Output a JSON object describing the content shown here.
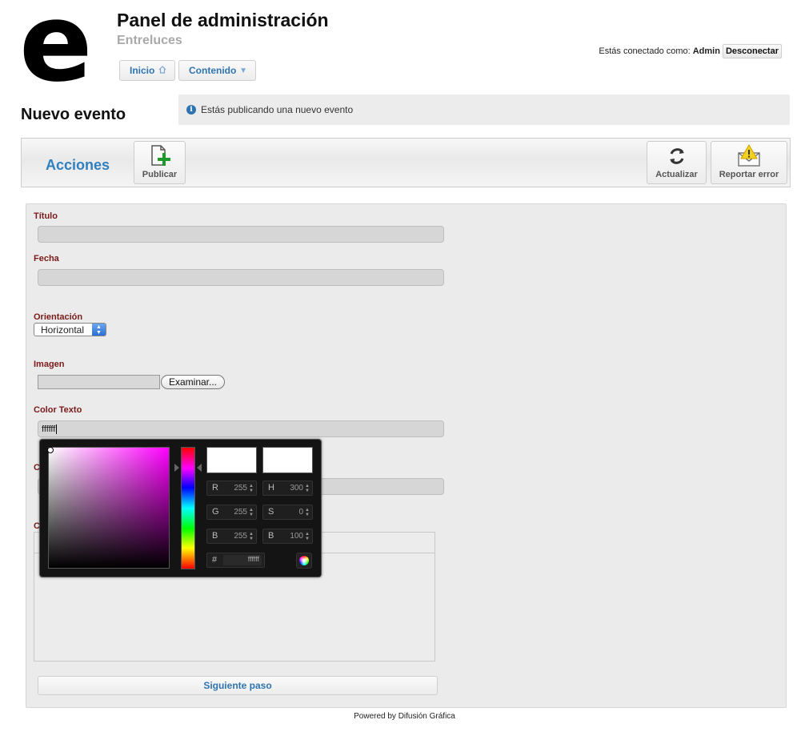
{
  "header": {
    "logo_letter": "e",
    "title": "Panel de administración",
    "subtitle": "Entreluces",
    "nav": [
      {
        "label": "Inicio",
        "icon": "home-icon"
      },
      {
        "label": "Contenido",
        "icon": "dropdown-arrow-icon"
      }
    ],
    "user_prefix": "Estás conectado como:",
    "user_name": "Admin",
    "logout_label": "Desconectar"
  },
  "page": {
    "title": "Nuevo evento",
    "notice": "Estás publicando una nuevo evento"
  },
  "toolbar": {
    "section_label": "Acciones",
    "publish_label": "Publicar",
    "refresh_label": "Actualizar",
    "report_label": "Reportar error"
  },
  "form": {
    "titulo_label": "Título",
    "titulo_value": "",
    "fecha_label": "Fecha",
    "fecha_value": "",
    "orientacion_label": "Orientación",
    "orientacion_value": "Horizontal",
    "imagen_label": "Imagen",
    "browse_label": "Examinar...",
    "color_label": "Color Texto",
    "color_value": "ffffff",
    "next_label": "Siguiente paso"
  },
  "color_picker": {
    "r": "255",
    "g": "255",
    "b": "255",
    "h": "300",
    "s": "0",
    "bri": "100",
    "hex": "ffffff",
    "hue_color": "#ff00ff",
    "current_color": "#ffffff"
  },
  "footer": {
    "text": "Powered by Difusión Gráfica"
  }
}
